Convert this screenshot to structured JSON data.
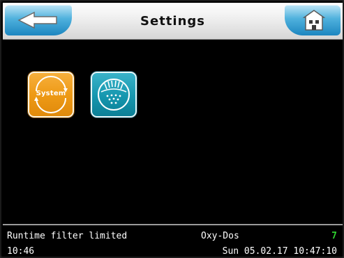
{
  "header": {
    "title": "Settings",
    "back_icon": "arrow-left-icon",
    "home_icon": "home-icon"
  },
  "tiles": [
    {
      "label": "System",
      "icon": "system-icon",
      "color": "#ee9a16"
    },
    {
      "label": "",
      "icon": "filter-icon",
      "color": "#1596ae"
    }
  ],
  "status": {
    "message": "Runtime filter limited",
    "time": "10:46",
    "mode": "Oxy-Dos",
    "count": "7",
    "count_color": "#2fd12f",
    "datetime": "Sun 05.02.17 10:47:10"
  },
  "colors": {
    "accent_blue": "#1d86c0",
    "header_bg": "#eeeeee",
    "screen_bg": "#000000"
  }
}
